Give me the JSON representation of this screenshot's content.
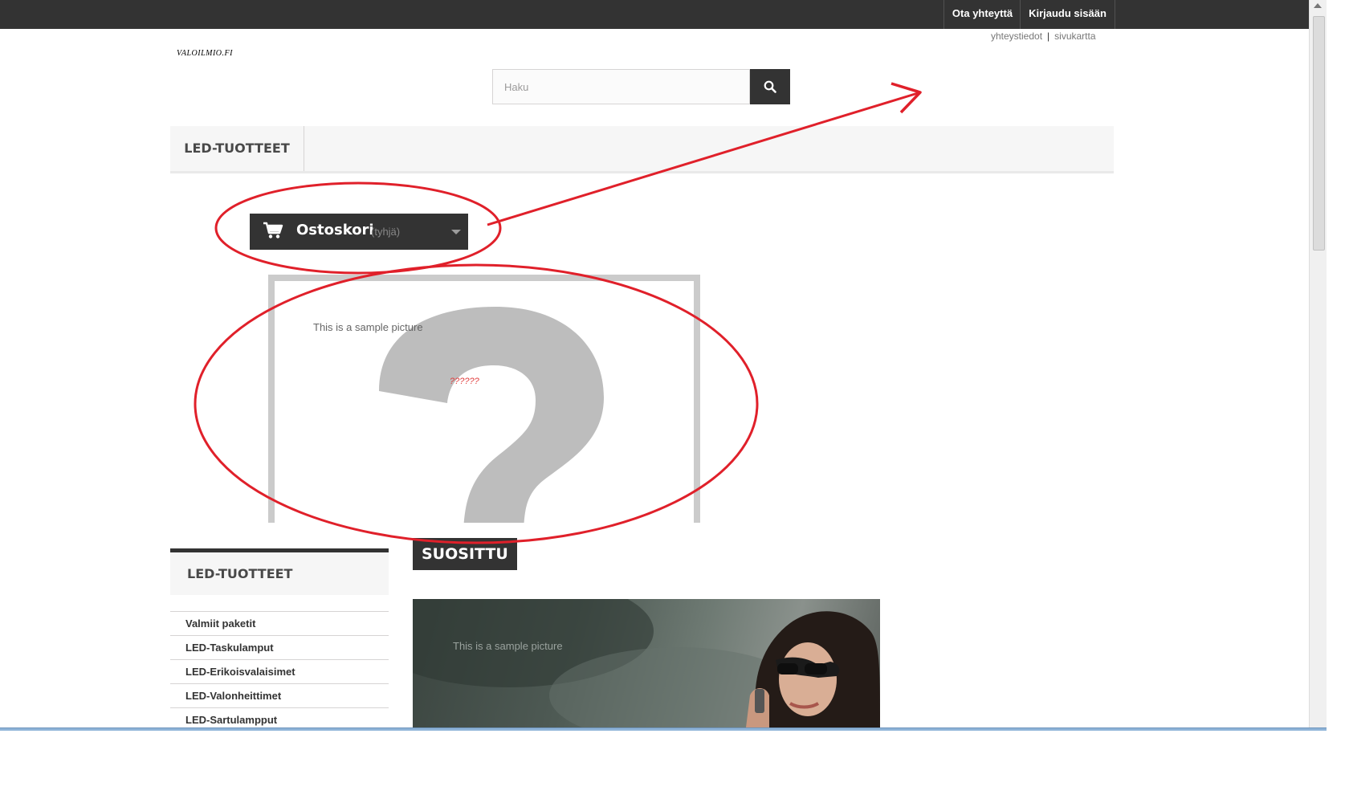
{
  "topbar": {
    "contact_label": "Ota yhteyttä",
    "login_label": "Kirjaudu sisään"
  },
  "util_links": {
    "contact": "yhteystiedot",
    "separator": "|",
    "sitemap": "sivukartta"
  },
  "logo": {
    "text": "VALOILMIO.FI"
  },
  "search": {
    "placeholder": "Haku",
    "button_icon": "search-icon"
  },
  "menu": {
    "items": [
      {
        "label": "LED-TUOTTEET"
      }
    ]
  },
  "cart": {
    "title": "Ostoskori",
    "status": "(tyhjä)",
    "icon": "cart-icon"
  },
  "sample_image": {
    "caption": "This is a sample picture",
    "broken_text": "??????"
  },
  "featured": {
    "title": "SUOSITTU"
  },
  "sidebar": {
    "title": "LED-TUOTTEET",
    "items": [
      {
        "label": "Valmiit paketit"
      },
      {
        "label": "LED-Taskulamput"
      },
      {
        "label": "LED-Erikoisvalaisimet"
      },
      {
        "label": "LED-Valonheittimet"
      },
      {
        "label": "LED-Sartulampput"
      }
    ]
  },
  "banner": {
    "caption": "This is a sample picture"
  },
  "colors": {
    "dark": "#333333",
    "annotation_red": "#e0202a",
    "menu_bg": "#f6f6f6"
  }
}
